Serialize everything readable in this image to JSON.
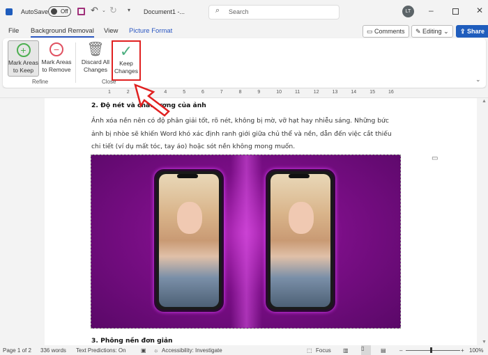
{
  "titlebar": {
    "autosave_label": "AutoSave",
    "autosave_state": "Off",
    "document_title": "Document1 -...",
    "search_placeholder": "Search",
    "user_initials": "LT"
  },
  "tabs": [
    {
      "label": "File"
    },
    {
      "label": "Background Removal",
      "active": true
    },
    {
      "label": "View"
    },
    {
      "label": "Picture Format"
    }
  ],
  "top_buttons": {
    "comments": "Comments",
    "editing": "Editing",
    "share": "Share"
  },
  "ribbon": {
    "mark_keep": "Mark Areas|to Keep",
    "mark_keep_1": "Mark Areas",
    "mark_keep_2": "to Keep",
    "mark_remove_1": "Mark Areas",
    "mark_remove_2": "to Remove",
    "discard_1": "Discard All",
    "discard_2": "Changes",
    "keep_1": "Keep",
    "keep_2": "Changes",
    "group_refine": "Refine",
    "group_close": "Close"
  },
  "ruler": [
    "1",
    "2",
    "3",
    "4",
    "5",
    "6",
    "7",
    "8",
    "9",
    "10",
    "11",
    "12",
    "13",
    "14",
    "15",
    "16"
  ],
  "document": {
    "heading1": "2. Độ nét và chất lượng của ảnh",
    "paragraph": "Ảnh xóa nền nên có độ phân giải tốt, rõ nét, không bị mờ, vỡ hạt hay nhiễu sáng. Những bức ảnh bị nhòe sẽ khiến Word khó xác định ranh giới giữa chủ thể và nền, dẫn đến việc cắt thiếu chi tiết (ví dụ mất tóc, tay áo) hoặc sót nền không mong muốn.",
    "heading2": "3. Phông nền đơn giản"
  },
  "status": {
    "page": "Page 1 of 2",
    "words": "336 words",
    "predictions": "Text Predictions: On",
    "accessibility": "Accessibility: Investigate",
    "focus": "Focus",
    "zoom": "100%",
    "zoom_level_percent": 100
  },
  "colors": {
    "accent": "#2b57c2",
    "share": "#1f5dbd",
    "highlight_box": "#e02020",
    "image_bg": "#7a0e86"
  }
}
